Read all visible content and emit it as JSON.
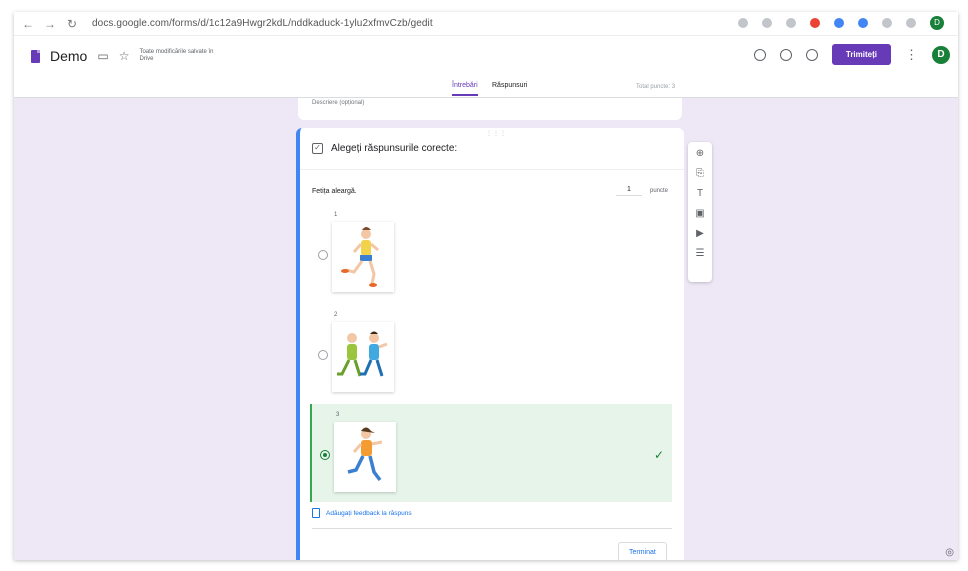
{
  "browser": {
    "url": "docs.google.com/forms/d/1c12a9Hwgr2kdL/nddkaduck-1ylu2xfmvCzb/gedit",
    "back_icon": "arrow-left-icon",
    "forward_icon": "arrow-right-icon",
    "reload_icon": "reload-icon"
  },
  "app": {
    "doc_title": "Demo",
    "saved_status": "Toate modificările salvate în Drive",
    "send_label": "Trimiteți",
    "avatar_letter": "D",
    "accent": "#673ab7"
  },
  "tabs": {
    "questions": "Întrebări",
    "responses": "Răspunsuri",
    "total_points": "Total puncte: 3"
  },
  "form": {
    "description_placeholder": "Descriere (opțional)",
    "question_header": "Alegeți răspunsurile corecte:",
    "question_text": "Fetița aleargă.",
    "points_value": "1",
    "points_label": "puncte",
    "options": [
      {
        "number": "1",
        "selected": false
      },
      {
        "number": "2",
        "selected": false
      },
      {
        "number": "3",
        "selected": true
      }
    ],
    "feedback_label": "Adăugați feedback la răspuns",
    "done_label": "Terminat"
  },
  "toolbar": [
    "add-question-icon",
    "import-questions-icon",
    "add-title-icon",
    "add-image-icon",
    "add-video-icon",
    "add-section-icon"
  ],
  "colors": {
    "correct": "#188038",
    "link": "#1a73e8",
    "canvas": "#ede7f6"
  }
}
